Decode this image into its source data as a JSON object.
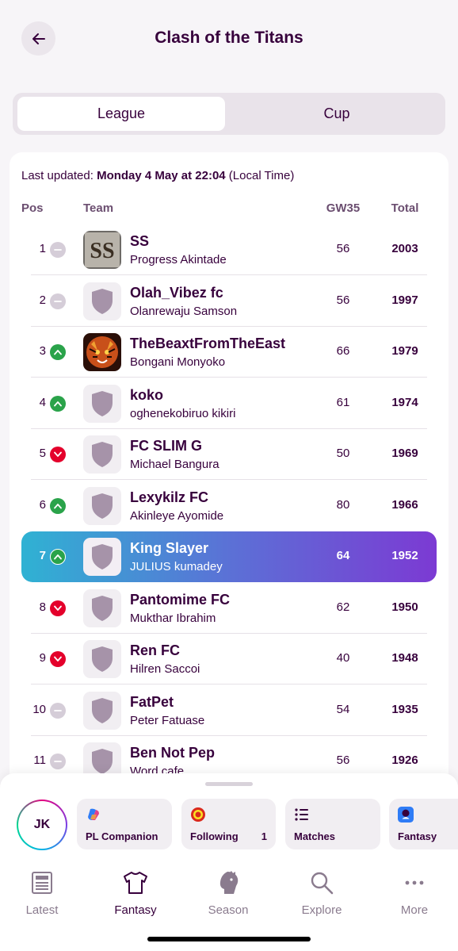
{
  "header": {
    "title": "Clash of the Titans"
  },
  "tabs": [
    {
      "label": "League",
      "active": true
    },
    {
      "label": "Cup",
      "active": false
    }
  ],
  "league": {
    "updated_prefix": "Last updated: ",
    "updated_date": "Monday 4 May at 22:04",
    "updated_suffix": " (Local Time)",
    "columns": {
      "pos": "Pos",
      "team": "Team",
      "gw": "GW35",
      "total": "Total"
    },
    "rows": [
      {
        "pos": "1",
        "move": "same",
        "team": "SS",
        "manager": "Progress Akintade",
        "gw": "56",
        "total": "2003",
        "badge": "ss-logo"
      },
      {
        "pos": "2",
        "move": "same",
        "team": "Olah_Vibez fc",
        "manager": "Olanrewaju Samson",
        "gw": "56",
        "total": "1997",
        "badge": "shield"
      },
      {
        "pos": "3",
        "move": "up",
        "team": "TheBeaxtFromTheEast",
        "manager": "Bongani Monyoko",
        "gw": "66",
        "total": "1979",
        "badge": "tiger-logo"
      },
      {
        "pos": "4",
        "move": "up",
        "team": "koko",
        "manager": "oghenekobiruo kikiri",
        "gw": "61",
        "total": "1974",
        "badge": "shield"
      },
      {
        "pos": "5",
        "move": "down",
        "team": "FC SLIM G",
        "manager": "Michael Bangura",
        "gw": "50",
        "total": "1969",
        "badge": "shield"
      },
      {
        "pos": "6",
        "move": "up",
        "team": "Lexykilz FC",
        "manager": "Akinleye Ayomide",
        "gw": "80",
        "total": "1966",
        "badge": "shield"
      },
      {
        "pos": "7",
        "move": "up",
        "team": "King Slayer",
        "manager": "JULIUS kumadey",
        "gw": "64",
        "total": "1952",
        "badge": "shield",
        "highlight": true
      },
      {
        "pos": "8",
        "move": "down",
        "team": "Pantomime FC",
        "manager": "Mukthar Ibrahim",
        "gw": "62",
        "total": "1950",
        "badge": "shield"
      },
      {
        "pos": "9",
        "move": "down",
        "team": "Ren FC",
        "manager": "Hilren Saccoi",
        "gw": "40",
        "total": "1948",
        "badge": "shield"
      },
      {
        "pos": "10",
        "move": "same",
        "team": "FatPet",
        "manager": "Peter Fatuase",
        "gw": "54",
        "total": "1935",
        "badge": "shield"
      },
      {
        "pos": "11",
        "move": "same",
        "team": "Ben Not Pep",
        "manager": "Word cafe",
        "gw": "56",
        "total": "1926",
        "badge": "shield"
      }
    ]
  },
  "sheet": {
    "avatar_initials": "JK",
    "shortcuts": [
      {
        "label": "PL Companion",
        "icon": "copilot-icon"
      },
      {
        "label": "Following",
        "count": "1",
        "icon": "man-utd-crest-icon"
      },
      {
        "label": "Matches",
        "icon": "list-icon"
      },
      {
        "label": "Fantasy",
        "icon": "premier-league-icon"
      }
    ]
  },
  "nav": [
    {
      "label": "Latest",
      "icon": "newspaper-icon",
      "active": false
    },
    {
      "label": "Fantasy",
      "icon": "shirt-icon",
      "active": true
    },
    {
      "label": "Season",
      "icon": "lion-icon",
      "active": false
    },
    {
      "label": "Explore",
      "icon": "search-icon",
      "active": false
    },
    {
      "label": "More",
      "icon": "more-icon",
      "active": false
    }
  ],
  "colors": {
    "brand": "#37003c",
    "highlight_start": "#2fb2d3",
    "highlight_end": "#7c3ad3",
    "up": "#2aa34a",
    "down": "#e4002b",
    "same": "#d5cdd8"
  }
}
